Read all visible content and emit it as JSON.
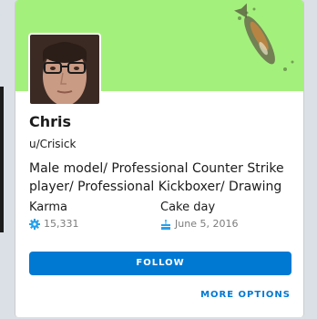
{
  "profile": {
    "display_name": "Chris",
    "username": "u/Crisick",
    "bio": "Male model/ Professional Counter Strike player/ Professional Kickboxer/ Drawing",
    "banner_color": "#a4f07c"
  },
  "stats": {
    "karma_label": "Karma",
    "karma_value": "15,331",
    "karma_icon": "karma-gear-icon",
    "cake_label": "Cake day",
    "cake_value": "June 5, 2016",
    "cake_icon": "cake-icon"
  },
  "actions": {
    "follow_label": "FOLLOW",
    "more_options_label": "MORE OPTIONS",
    "accent_color": "#0079d3"
  }
}
